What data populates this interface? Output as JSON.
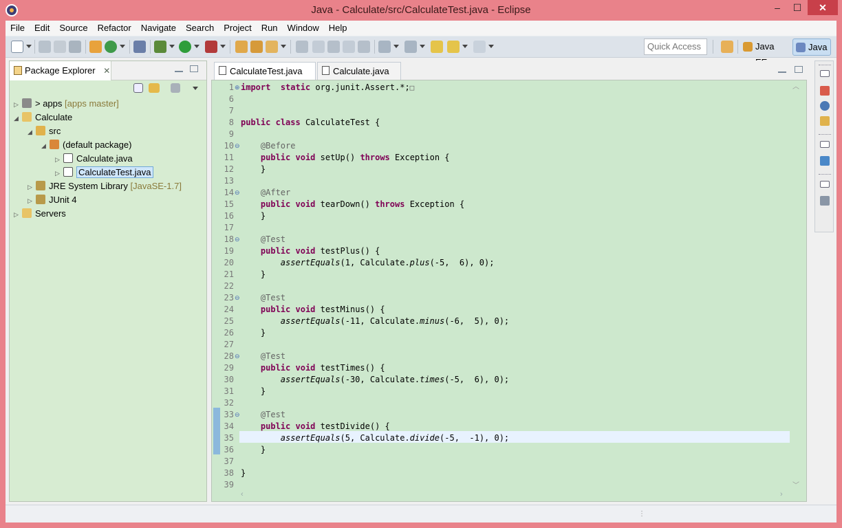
{
  "window": {
    "title": "Java - Calculate/src/CalculateTest.java - Eclipse",
    "minimize": "–",
    "maximize": "☐",
    "close": "✕"
  },
  "menu": [
    "File",
    "Edit",
    "Source",
    "Refactor",
    "Navigate",
    "Search",
    "Project",
    "Run",
    "Window",
    "Help"
  ],
  "toolbar": {
    "quick_access_placeholder": "Quick Access",
    "perspectives": [
      "Java EE",
      "Java"
    ],
    "active_perspective": "Java"
  },
  "package_explorer": {
    "title": "Package Explorer",
    "close": "✕",
    "tree": [
      {
        "label": "> apps",
        "decoration": "[apps master]",
        "arrow": "▷"
      },
      {
        "label": "Calculate",
        "decoration": "",
        "arrow": "◢"
      },
      {
        "label": "src",
        "decoration": "",
        "arrow": "◢"
      },
      {
        "label": "(default package)",
        "decoration": "",
        "arrow": "◢"
      },
      {
        "label": "Calculate.java",
        "decoration": "",
        "arrow": "▷"
      },
      {
        "label": "CalculateTest.java",
        "decoration": "",
        "arrow": "▷"
      },
      {
        "label": "JRE System Library",
        "decoration": "[JavaSE-1.7]",
        "arrow": "▷"
      },
      {
        "label": "JUnit 4",
        "decoration": "",
        "arrow": "▷"
      },
      {
        "label": "Servers",
        "decoration": "",
        "arrow": "▷"
      }
    ],
    "selected": "CalculateTest.java"
  },
  "editor": {
    "tabs": [
      {
        "label": "CalculateTest.java",
        "close": "✕"
      },
      {
        "label": "Calculate.java",
        "close": "✕"
      }
    ],
    "active_tab": "CalculateTest.java",
    "current_line": "35",
    "lines": [
      {
        "n": "1",
        "fold": "⊕",
        "code": [
          [
            "kw",
            "import"
          ],
          [
            "",
            "  "
          ],
          [
            "kw",
            "static"
          ],
          [
            "",
            " org.junit.Assert.*;"
          ],
          [
            "box",
            "□"
          ]
        ]
      },
      {
        "n": "6",
        "fold": "",
        "code": []
      },
      {
        "n": "7",
        "fold": "",
        "code": []
      },
      {
        "n": "8",
        "fold": "",
        "code": [
          [
            "kw",
            "public"
          ],
          [
            "",
            " "
          ],
          [
            "kw",
            "class"
          ],
          [
            "",
            " CalculateTest {"
          ]
        ]
      },
      {
        "n": "9",
        "fold": "",
        "code": []
      },
      {
        "n": "10",
        "fold": "⊖",
        "code": [
          [
            "",
            "    "
          ],
          [
            "ann",
            "@Before"
          ]
        ]
      },
      {
        "n": "11",
        "fold": "",
        "code": [
          [
            "",
            "    "
          ],
          [
            "kw",
            "public"
          ],
          [
            "",
            " "
          ],
          [
            "kw",
            "void"
          ],
          [
            "",
            " setUp() "
          ],
          [
            "kw",
            "throws"
          ],
          [
            "",
            " Exception {"
          ]
        ]
      },
      {
        "n": "12",
        "fold": "",
        "code": [
          [
            "",
            "    }"
          ]
        ]
      },
      {
        "n": "13",
        "fold": "",
        "code": []
      },
      {
        "n": "14",
        "fold": "⊖",
        "code": [
          [
            "",
            "    "
          ],
          [
            "ann",
            "@After"
          ]
        ]
      },
      {
        "n": "15",
        "fold": "",
        "code": [
          [
            "",
            "    "
          ],
          [
            "kw",
            "public"
          ],
          [
            "",
            " "
          ],
          [
            "kw",
            "void"
          ],
          [
            "",
            " tearDown() "
          ],
          [
            "kw",
            "throws"
          ],
          [
            "",
            " Exception {"
          ]
        ]
      },
      {
        "n": "16",
        "fold": "",
        "code": [
          [
            "",
            "    }"
          ]
        ]
      },
      {
        "n": "17",
        "fold": "",
        "code": []
      },
      {
        "n": "18",
        "fold": "⊖",
        "code": [
          [
            "",
            "    "
          ],
          [
            "ann",
            "@Test"
          ]
        ]
      },
      {
        "n": "19",
        "fold": "",
        "code": [
          [
            "",
            "    "
          ],
          [
            "kw",
            "public"
          ],
          [
            "",
            " "
          ],
          [
            "kw",
            "void"
          ],
          [
            "",
            " testPlus() {"
          ]
        ]
      },
      {
        "n": "20",
        "fold": "",
        "code": [
          [
            "",
            "        "
          ],
          [
            "it",
            "assertEquals"
          ],
          [
            "",
            "(1, Calculate."
          ],
          [
            "it",
            "plus"
          ],
          [
            "",
            "(-5,  6), 0);"
          ]
        ]
      },
      {
        "n": "21",
        "fold": "",
        "code": [
          [
            "",
            "    }"
          ]
        ]
      },
      {
        "n": "22",
        "fold": "",
        "code": []
      },
      {
        "n": "23",
        "fold": "⊖",
        "code": [
          [
            "",
            "    "
          ],
          [
            "ann",
            "@Test"
          ]
        ]
      },
      {
        "n": "24",
        "fold": "",
        "code": [
          [
            "",
            "    "
          ],
          [
            "kw",
            "public"
          ],
          [
            "",
            " "
          ],
          [
            "kw",
            "void"
          ],
          [
            "",
            " testMinus() {"
          ]
        ]
      },
      {
        "n": "25",
        "fold": "",
        "code": [
          [
            "",
            "        "
          ],
          [
            "it",
            "assertEquals"
          ],
          [
            "",
            "(-11, Calculate."
          ],
          [
            "it",
            "minus"
          ],
          [
            "",
            "(-6,  5), 0);"
          ]
        ]
      },
      {
        "n": "26",
        "fold": "",
        "code": [
          [
            "",
            "    }"
          ]
        ]
      },
      {
        "n": "27",
        "fold": "",
        "code": []
      },
      {
        "n": "28",
        "fold": "⊖",
        "code": [
          [
            "",
            "    "
          ],
          [
            "ann",
            "@Test"
          ]
        ]
      },
      {
        "n": "29",
        "fold": "",
        "code": [
          [
            "",
            "    "
          ],
          [
            "kw",
            "public"
          ],
          [
            "",
            " "
          ],
          [
            "kw",
            "void"
          ],
          [
            "",
            " testTimes() {"
          ]
        ]
      },
      {
        "n": "30",
        "fold": "",
        "code": [
          [
            "",
            "        "
          ],
          [
            "it",
            "assertEquals"
          ],
          [
            "",
            "(-30, Calculate."
          ],
          [
            "it",
            "times"
          ],
          [
            "",
            "(-5,  6), 0);"
          ]
        ]
      },
      {
        "n": "31",
        "fold": "",
        "code": [
          [
            "",
            "    }"
          ]
        ]
      },
      {
        "n": "32",
        "fold": "",
        "code": []
      },
      {
        "n": "33",
        "fold": "⊖",
        "code": [
          [
            "",
            "    "
          ],
          [
            "ann",
            "@Test"
          ]
        ]
      },
      {
        "n": "34",
        "fold": "",
        "code": [
          [
            "",
            "    "
          ],
          [
            "kw",
            "public"
          ],
          [
            "",
            " "
          ],
          [
            "kw",
            "void"
          ],
          [
            "",
            " testDivide() {"
          ]
        ]
      },
      {
        "n": "35",
        "fold": "",
        "code": [
          [
            "",
            "        "
          ],
          [
            "it",
            "assertEquals"
          ],
          [
            "",
            "(5, Calculate."
          ],
          [
            "it",
            "divide"
          ],
          [
            "",
            "(-5,  -1), 0);"
          ]
        ]
      },
      {
        "n": "36",
        "fold": "",
        "code": [
          [
            "",
            "    }"
          ]
        ]
      },
      {
        "n": "37",
        "fold": "",
        "code": []
      },
      {
        "n": "38",
        "fold": "",
        "code": [
          [
            "",
            "}"
          ]
        ]
      },
      {
        "n": "39",
        "fold": "",
        "code": []
      }
    ]
  },
  "colors": {
    "titlebar": "#e9828a",
    "editor_bg": "#cde8cd",
    "explorer_bg": "#d7ecd2",
    "keyword": "#7f0055",
    "annotation": "#646464",
    "current_line": "#e8f2fe"
  },
  "icons": [
    "eclipse-icon",
    "new-icon",
    "save-icon",
    "debug-icon",
    "run-icon",
    "open-perspective-icon",
    "java-ee-icon",
    "java-icon",
    "collapse-all-icon",
    "link-editor-icon",
    "view-menu-icon",
    "minimize-icon",
    "maximize-icon",
    "java-file-icon",
    "package-icon",
    "folder-icon",
    "library-icon"
  ]
}
